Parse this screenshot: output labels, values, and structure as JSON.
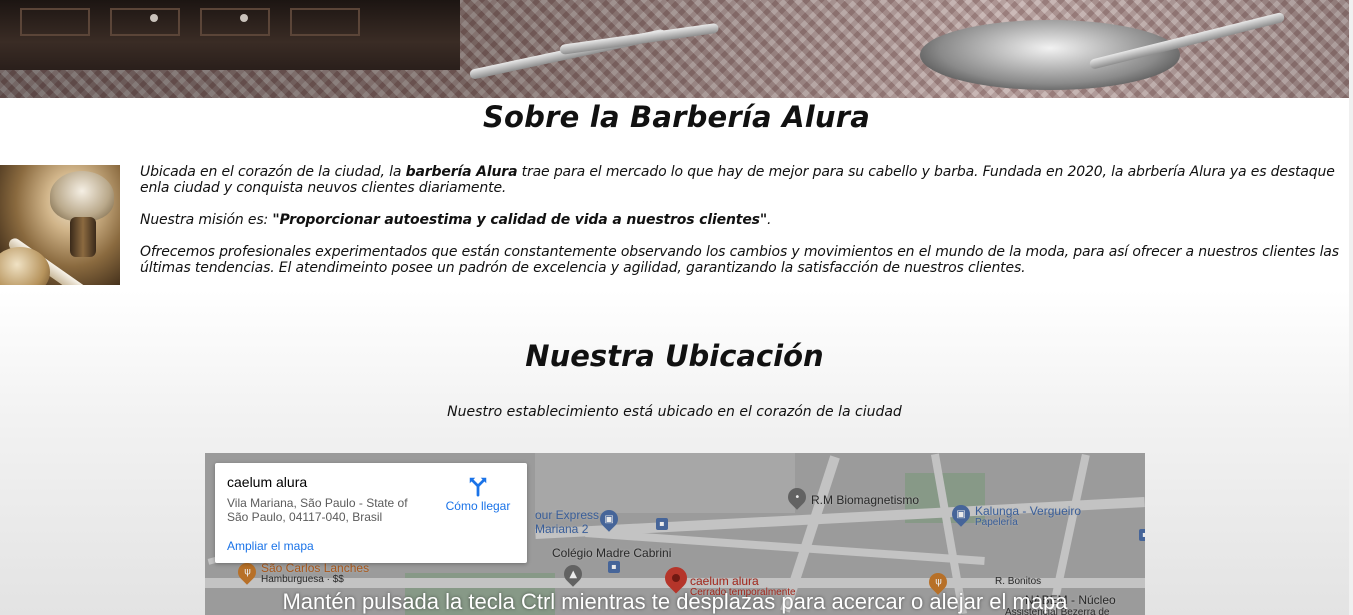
{
  "about": {
    "title": "Sobre la Barbería Alura",
    "p1_before": "Ubicada en el corazón de la ciudad, la ",
    "p1_bold": "barbería Alura",
    "p1_after": " trae para el mercado lo que hay de mejor para su cabello y barba. Fundada en 2020, la abrbería Alura ya es destaque enla ciudad y conquista neuvos clientes diariamente.",
    "p2_before": "Nuestra misión es: ",
    "p2_bold": "\"Proporcionar autoestima y calidad de vida a nuestros clientes\"",
    "p2_after": ".",
    "p3": "Ofrecemos profesionales experimentados que están constantemente observando los cambios y movimientos en el mundo de la moda, para así ofrecer a nuestros clientes las últimas tendencias. El atendimeinto posee un padrón de excelencia y agilidad, garantizando la satisfacción de nuestros clientes."
  },
  "location": {
    "title": "Nuestra Ubicación",
    "subtitle": "Nuestro establecimiento está ubicado en el corazón de la ciudad"
  },
  "map": {
    "place_name": "caelum alura",
    "address": "Vila Mariana, São Paulo - State of São Paulo, 04117-040, Brasil",
    "directions_label": "Cómo llegar",
    "enlarge_label": "Ampliar el mapa",
    "overlay_message": "Mantén pulsada la tecla Ctrl mientras te desplazas para acercar o alejar el mapa",
    "labels": {
      "rm_bio": "R.M Biomagnetismo",
      "kalunga": "Kalunga - Vergueiro",
      "kalunga_sub": "Papelería",
      "express_1": "our Express",
      "express_2": "Mariana 2",
      "colegio": "Colégio Madre Cabrini",
      "sao_carlos": "São Carlos Lanches",
      "sao_carlos_sub": "Hamburguesa · $$",
      "marker_name": "caelum alura",
      "marker_sub": "Cerrado temporalmente",
      "r_bonitos": "R. Bonitos",
      "nabem": "NABEM - Núcleo",
      "nabem_2": "Assistencial Bezerra de"
    },
    "accent_color": "#1a73e8",
    "marker_color": "#c53a2e"
  }
}
